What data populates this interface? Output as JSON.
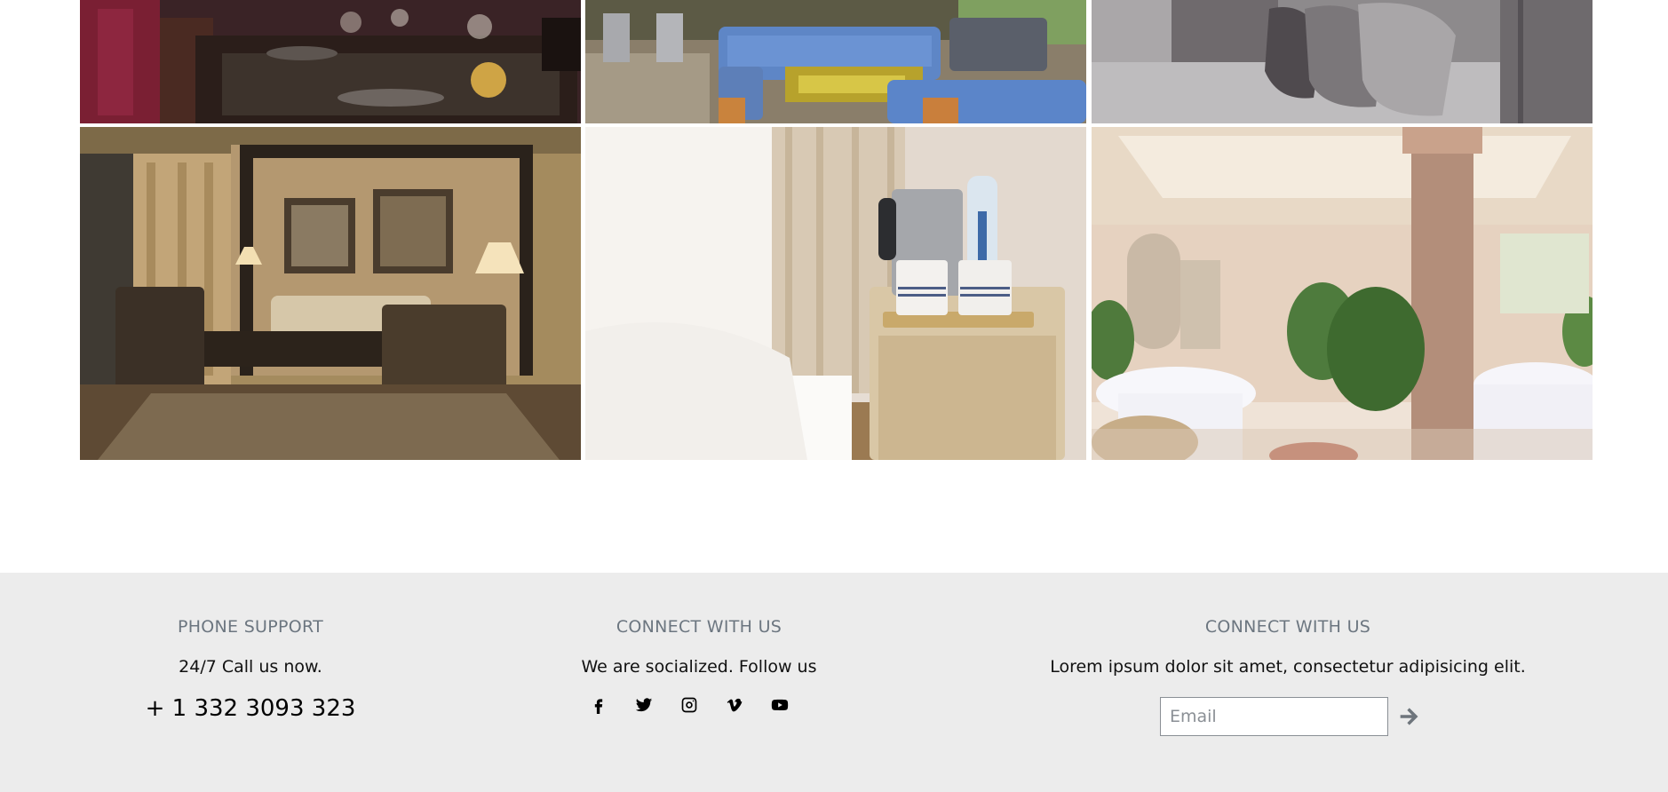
{
  "gallery": {
    "photos": [
      {
        "name": "restaurant-table"
      },
      {
        "name": "lounge-sofas"
      },
      {
        "name": "bed-pillows"
      },
      {
        "name": "living-room"
      },
      {
        "name": "bedside-kettle"
      },
      {
        "name": "dining-hall"
      }
    ]
  },
  "footer": {
    "phone": {
      "title": "PHONE SUPPORT",
      "subtitle": "24/7 Call us now.",
      "number": "+ 1 332 3093 323"
    },
    "social": {
      "title": "CONNECT WITH US",
      "subtitle": "We are socialized. Follow us",
      "icons": [
        "facebook-icon",
        "twitter-icon",
        "instagram-icon",
        "vimeo-icon",
        "youtube-icon"
      ]
    },
    "newsletter": {
      "title": "CONNECT WITH US",
      "subtitle": "Lorem ipsum dolor sit amet, consectetur adipisicing elit.",
      "email_placeholder": "Email",
      "submit_icon": "arrow-right-icon"
    }
  },
  "colors": {
    "footer_bg": "#ececec",
    "title_gray": "#6c7680",
    "arrow_gray": "#6e757c"
  }
}
